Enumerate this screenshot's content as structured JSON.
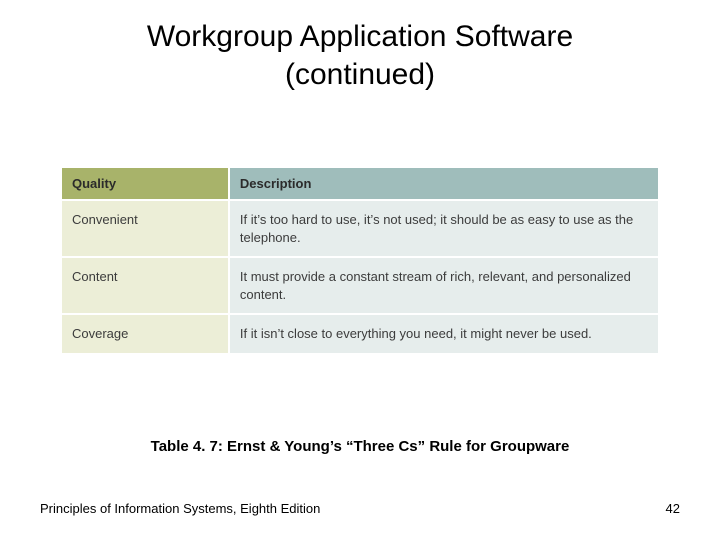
{
  "slide": {
    "title_line1": "Workgroup Application Software",
    "title_line2": "(continued)",
    "caption": "Table 4. 7: Ernst & Young’s “Three Cs” Rule for Groupware",
    "footer": "Principles of Information Systems, Eighth Edition",
    "page_number": "42"
  },
  "table": {
    "headers": {
      "quality": "Quality",
      "description": "Description"
    },
    "rows": [
      {
        "quality": "Convenient",
        "description": "If it’s too hard to use, it’s not used; it should be as easy to use as the telephone."
      },
      {
        "quality": "Content",
        "description": "It must provide a constant stream of rich, relevant, and personalized content."
      },
      {
        "quality": "Coverage",
        "description": "If it isn’t close to everything you need, it might never be used."
      }
    ]
  },
  "chart_data": {
    "type": "table",
    "title": "Ernst & Young’s “Three Cs” Rule for Groupware",
    "columns": [
      "Quality",
      "Description"
    ],
    "rows": [
      [
        "Convenient",
        "If it’s too hard to use, it’s not used; it should be as easy to use as the telephone."
      ],
      [
        "Content",
        "It must provide a constant stream of rich, relevant, and personalized content."
      ],
      [
        "Coverage",
        "If it isn’t close to everything you need, it might never be used."
      ]
    ]
  }
}
